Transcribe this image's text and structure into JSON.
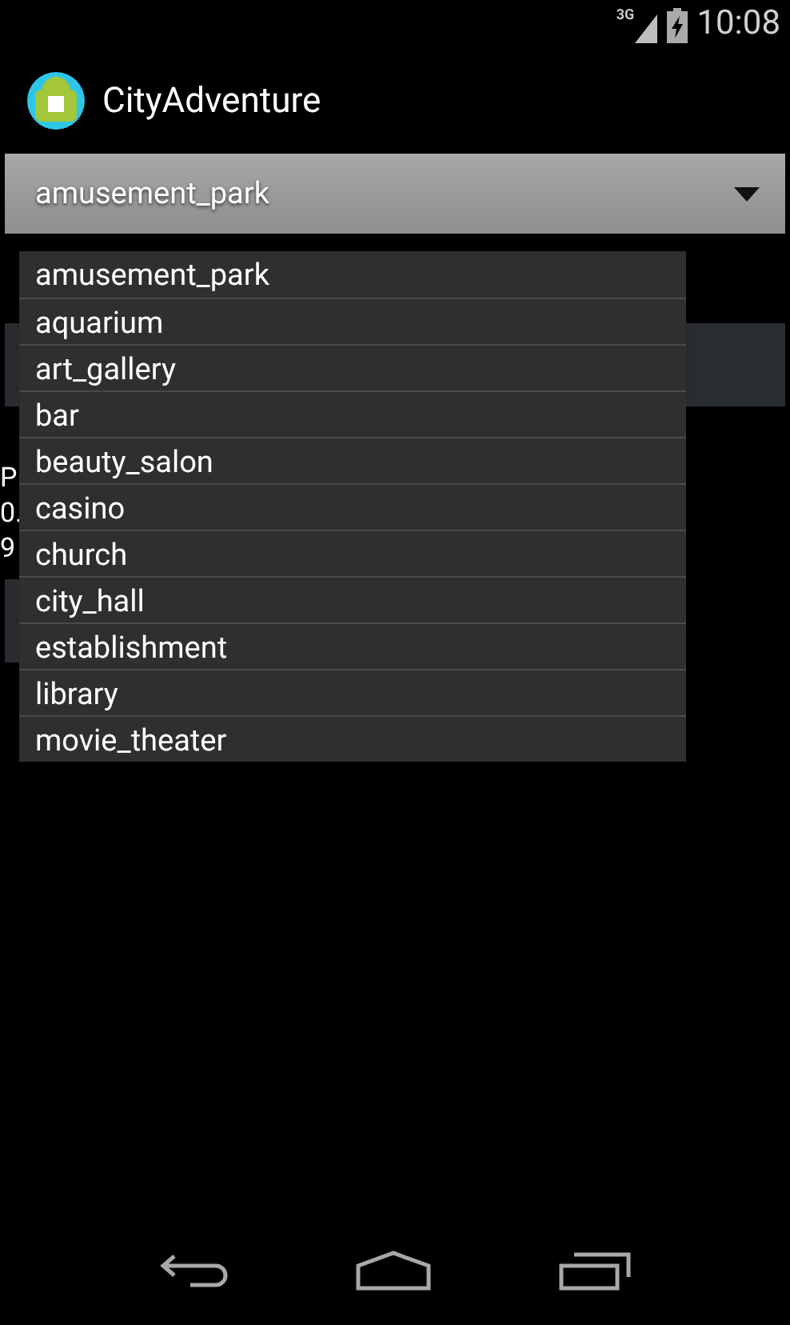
{
  "status_bar": {
    "network": "3G",
    "time": "10:08"
  },
  "action_bar": {
    "title": "CityAdventure"
  },
  "spinner": {
    "value": "amusement_park",
    "expanded": true
  },
  "background_texts": [
    "P",
    "0.",
    "9"
  ],
  "dropdown": {
    "options": [
      {
        "label": "amusement_park"
      },
      {
        "label": "aquarium"
      },
      {
        "label": "art_gallery"
      },
      {
        "label": "bar"
      },
      {
        "label": "beauty_salon"
      },
      {
        "label": "casino"
      },
      {
        "label": "church"
      },
      {
        "label": "city_hall"
      },
      {
        "label": "establishment"
      },
      {
        "label": "library"
      },
      {
        "label": "movie_theater"
      }
    ]
  }
}
